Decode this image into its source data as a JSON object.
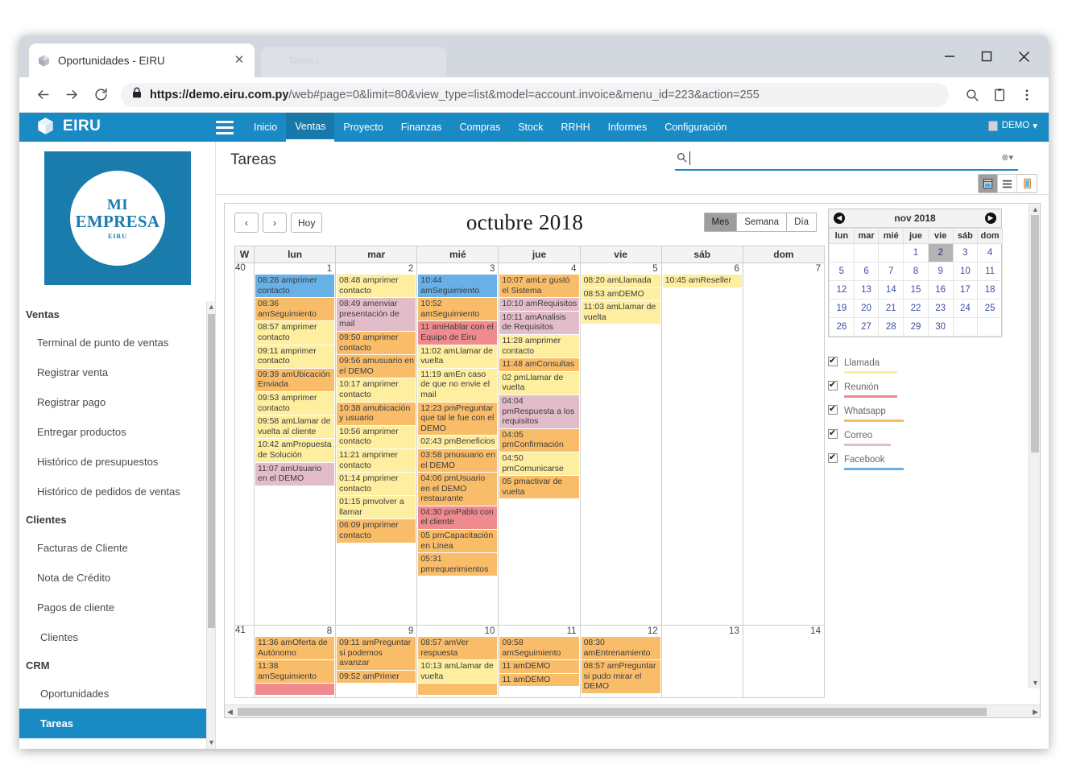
{
  "browser": {
    "tab_title": "Oportunidades - EIRU",
    "ghost_tab_title": "Tareas",
    "url_domain": "https://demo.eiru.com.py",
    "url_rest": "/web#page=0&limit=80&view_type=list&model=account.invoice&menu_id=223&action=255",
    "back_icon": "arrow-left-icon",
    "forward_icon": "arrow-right-icon",
    "reload_icon": "reload-icon",
    "lock_icon": "lock-icon",
    "zoom_icon": "zoom-search-icon",
    "save_icon": "save-page-icon",
    "menu_icon": "kebab-menu-icon",
    "minimize_label": "Minimizar",
    "maximize_label": "Maximizar",
    "close_label": "Cerrar"
  },
  "appbar": {
    "brand": "EIRU",
    "hamburger_icon": "hamburger-icon",
    "menu": [
      {
        "label": "Inicio",
        "active": false
      },
      {
        "label": "Ventas",
        "active": true
      },
      {
        "label": "Proyecto",
        "active": false
      },
      {
        "label": "Finanzas",
        "active": false
      },
      {
        "label": "Compras",
        "active": false
      },
      {
        "label": "Stock",
        "active": false
      },
      {
        "label": "RRHH",
        "active": false
      },
      {
        "label": "Informes",
        "active": false
      },
      {
        "label": "Configuración",
        "active": false
      }
    ],
    "user": "DEMO",
    "user_caret": "▾"
  },
  "sidebar": {
    "logo": {
      "line1": "MI",
      "line2": "EMPRESA",
      "line3": "EIRU"
    },
    "items": [
      {
        "label": "Ventas",
        "type": "group"
      },
      {
        "label": "Terminal de punto de ventas",
        "type": "item"
      },
      {
        "label": "Registrar venta",
        "type": "item"
      },
      {
        "label": "Registrar pago",
        "type": "item"
      },
      {
        "label": "Entregar productos",
        "type": "item"
      },
      {
        "label": "Histórico de presupuestos",
        "type": "item"
      },
      {
        "label": "Histórico de pedidos de ventas",
        "type": "item"
      },
      {
        "label": "Clientes",
        "type": "group"
      },
      {
        "label": "Facturas de Cliente",
        "type": "item"
      },
      {
        "label": "Nota de Crédito",
        "type": "item"
      },
      {
        "label": "Pagos de cliente",
        "type": "item"
      },
      {
        "label": "Clientes",
        "type": "item2"
      },
      {
        "label": "CRM",
        "type": "group"
      },
      {
        "label": "Oportunidades",
        "type": "item2"
      },
      {
        "label": "Tareas",
        "type": "item2",
        "selected": true
      }
    ]
  },
  "control_bar": {
    "title": "Tareas",
    "search_value": "",
    "search_icon": "search-icon",
    "search_clear_icon": "clear-filter-icon",
    "views": [
      {
        "name": "calendar-view-button",
        "icon": "calendar-icon",
        "active": true
      },
      {
        "name": "list-view-button",
        "icon": "list-icon",
        "active": false
      },
      {
        "name": "form-view-button",
        "icon": "form-icon",
        "active": false
      }
    ]
  },
  "calendar": {
    "prev_label": "‹",
    "next_label": "›",
    "today_label": "Hoy",
    "title": "octubre 2018",
    "view_buttons": [
      {
        "label": "Mes",
        "active": true
      },
      {
        "label": "Semana",
        "active": false
      },
      {
        "label": "Día",
        "active": false
      }
    ],
    "columns": [
      "W",
      "lun",
      "mar",
      "mié",
      "jue",
      "vie",
      "sáb",
      "dom"
    ],
    "weeks": [
      {
        "week": "40",
        "days": [
          {
            "num": "1",
            "events": [
              {
                "time": "08:28 am",
                "title": "primer contacto",
                "cat": "facebook"
              },
              {
                "time": "08:36 am",
                "title": "Seguimiento",
                "cat": "whatsapp"
              },
              {
                "time": "08:57 am",
                "title": "primer contacto",
                "cat": "llamada"
              },
              {
                "time": "09:11 am",
                "title": "primer contacto",
                "cat": "llamada"
              },
              {
                "time": "09:39 am",
                "title": "Ubicación Enviada",
                "cat": "whatsapp"
              },
              {
                "time": "09:53 am",
                "title": "primer contacto",
                "cat": "llamada"
              },
              {
                "time": "09:58 am",
                "title": "Llamar de vuelta al cliente",
                "cat": "llamada"
              },
              {
                "time": "10:42 am",
                "title": "Propuesta de Solución",
                "cat": "llamada"
              },
              {
                "time": "11:07 am",
                "title": "Usuario en el DEMO",
                "cat": "correo"
              }
            ]
          },
          {
            "num": "2",
            "events": [
              {
                "time": "08:48 am",
                "title": "primer contacto",
                "cat": "llamada"
              },
              {
                "time": "08:49 am",
                "title": "enviar presentación de mail",
                "cat": "correo"
              },
              {
                "time": "09:50 am",
                "title": "primer contacto",
                "cat": "whatsapp"
              },
              {
                "time": "09:56 am",
                "title": "usuario en el DEMO",
                "cat": "whatsapp"
              },
              {
                "time": "10:17 am",
                "title": "primer contacto",
                "cat": "llamada"
              },
              {
                "time": "10:38 am",
                "title": "ubicación y usuario",
                "cat": "whatsapp"
              },
              {
                "time": "10:56 am",
                "title": "primer contacto",
                "cat": "llamada"
              },
              {
                "time": "11:21 am",
                "title": "primer contacto",
                "cat": "llamada"
              },
              {
                "time": "01:14 pm",
                "title": "primer contacto",
                "cat": "llamada"
              },
              {
                "time": "01:15 pm",
                "title": "volver a llamar",
                "cat": "llamada"
              },
              {
                "time": "06:09 pm",
                "title": "primer contacto",
                "cat": "whatsapp"
              }
            ]
          },
          {
            "num": "3",
            "events": [
              {
                "time": "10:44 am",
                "title": "Seguimiento",
                "cat": "facebook"
              },
              {
                "time": "10:52 am",
                "title": "Seguimiento",
                "cat": "whatsapp"
              },
              {
                "time": "11 am",
                "title": "Hablar con el Equipo de Eiru",
                "cat": "reunion"
              },
              {
                "time": "11:02 am",
                "title": "Llamar de vuelta",
                "cat": "llamada"
              },
              {
                "time": "11:19 am",
                "title": "En caso de que no envie el mail",
                "cat": "llamada"
              },
              {
                "time": "12:23 pm",
                "title": "Preguntar que tal le fue con el DEMO",
                "cat": "whatsapp"
              },
              {
                "time": "02:43 pm",
                "title": "Beneficios",
                "cat": "llamada"
              },
              {
                "time": "03:58 pm",
                "title": "usuario en el DEMO",
                "cat": "whatsapp"
              },
              {
                "time": "04:06 pm",
                "title": "Usuario en el DEMO restaurante",
                "cat": "whatsapp"
              },
              {
                "time": "04:30 pm",
                "title": "Pablo con el cliente",
                "cat": "reunion"
              },
              {
                "time": "05 pm",
                "title": "Capacitación en Linea",
                "cat": "whatsapp"
              },
              {
                "time": "05:31 pm",
                "title": "requerimientos",
                "cat": "whatsapp"
              }
            ]
          },
          {
            "num": "4",
            "events": [
              {
                "time": "10:07 am",
                "title": "Le gustó el Sistema",
                "cat": "whatsapp"
              },
              {
                "time": "10:10 am",
                "title": "Requisitos",
                "cat": "correo"
              },
              {
                "time": "10:11 am",
                "title": "Analisis de Requisitos",
                "cat": "correo"
              },
              {
                "time": "11:28 am",
                "title": "primer contacto",
                "cat": "llamada"
              },
              {
                "time": "11:48 am",
                "title": "Consultas",
                "cat": "whatsapp"
              },
              {
                "time": "02 pm",
                "title": "Llamar de vuelta",
                "cat": "llamada"
              },
              {
                "time": "04:04 pm",
                "title": "Respuesta a los requisitos",
                "cat": "correo"
              },
              {
                "time": "04:05 pm",
                "title": "Confirmación",
                "cat": "whatsapp"
              },
              {
                "time": "04:50 pm",
                "title": "Comunicarse",
                "cat": "llamada"
              },
              {
                "time": "05 pm",
                "title": "activar de vuelta",
                "cat": "whatsapp"
              }
            ]
          },
          {
            "num": "5",
            "events": [
              {
                "time": "08:20 am",
                "title": "Llamada",
                "cat": "llamada"
              },
              {
                "time": "08:53 am",
                "title": "DEMO",
                "cat": "llamada"
              },
              {
                "time": "11:03 am",
                "title": "Llamar de vuelta",
                "cat": "llamada"
              }
            ]
          },
          {
            "num": "6",
            "events": [
              {
                "time": "10:45 am",
                "title": "Reseller",
                "cat": "llamada"
              }
            ]
          },
          {
            "num": "7",
            "events": []
          }
        ]
      },
      {
        "week": "41",
        "days": [
          {
            "num": "8",
            "events": [
              {
                "time": "11:36 am",
                "title": "Oferta de Autónomo",
                "cat": "whatsapp"
              },
              {
                "time": "11:38 am",
                "title": "Seguimiento",
                "cat": "whatsapp"
              },
              {
                "time": "",
                "title": "",
                "cat": "reunion"
              }
            ]
          },
          {
            "num": "9",
            "events": [
              {
                "time": "09:11 am",
                "title": "Preguntar si podemos avanzar",
                "cat": "whatsapp"
              },
              {
                "time": "09:52 am",
                "title": "Primer",
                "cat": "whatsapp"
              }
            ]
          },
          {
            "num": "10",
            "events": [
              {
                "time": "08:57 am",
                "title": "Ver respuesta",
                "cat": "whatsapp"
              },
              {
                "time": "10:13 am",
                "title": "Llamar de vuelta",
                "cat": "llamada"
              },
              {
                "time": "",
                "title": "",
                "cat": "whatsapp"
              }
            ]
          },
          {
            "num": "11",
            "events": [
              {
                "time": "09:58 am",
                "title": "Seguimiento",
                "cat": "whatsapp"
              },
              {
                "time": "11 am",
                "title": "DEMO",
                "cat": "whatsapp"
              },
              {
                "time": "11 am",
                "title": "DEMO",
                "cat": "whatsapp"
              }
            ]
          },
          {
            "num": "12",
            "events": [
              {
                "time": "08:30 am",
                "title": "Entrenamiento",
                "cat": "whatsapp"
              },
              {
                "time": "08:57 am",
                "title": "Preguntar si pudo mirar el DEMO",
                "cat": "whatsapp"
              }
            ]
          },
          {
            "num": "13",
            "events": []
          },
          {
            "num": "14",
            "events": []
          }
        ]
      }
    ]
  },
  "minical": {
    "title": "nov 2018",
    "prev_icon": "chevron-left-icon",
    "next_icon": "chevron-right-icon",
    "weekdays": [
      "lun",
      "mar",
      "mié",
      "jue",
      "vie",
      "sáb",
      "dom"
    ],
    "weeks": [
      [
        "",
        "",
        "",
        "1",
        "2",
        "3",
        "4"
      ],
      [
        "5",
        "6",
        "7",
        "8",
        "9",
        "10",
        "11"
      ],
      [
        "12",
        "13",
        "14",
        "15",
        "16",
        "17",
        "18"
      ],
      [
        "19",
        "20",
        "21",
        "22",
        "23",
        "24",
        "25"
      ],
      [
        "26",
        "27",
        "28",
        "29",
        "30",
        "",
        ""
      ]
    ],
    "selected": "2"
  },
  "legend": {
    "items": [
      {
        "label": "Llamada",
        "color": "#fdeea0",
        "checked": true
      },
      {
        "label": "Reunión",
        "color": "#ef8a8f",
        "checked": true
      },
      {
        "label": "Whatsapp",
        "color": "#f9bd6a",
        "checked": true
      },
      {
        "label": "Correo",
        "color": "#e3bcca",
        "checked": true
      },
      {
        "label": "Facebook",
        "color": "#68b0e8",
        "checked": true
      }
    ]
  },
  "colors": {
    "brand_blue": "#1a8ac4",
    "logo_blue": "#1a7bad",
    "accent_link": "#3d4ea0"
  }
}
